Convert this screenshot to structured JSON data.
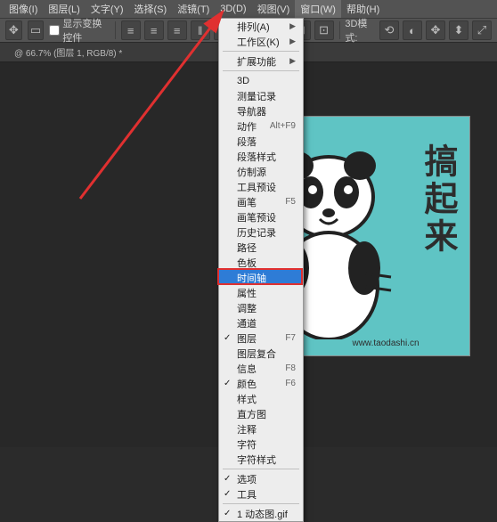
{
  "menubar": {
    "items": [
      "图像(I)",
      "图层(L)",
      "文字(Y)",
      "选择(S)",
      "滤镜(T)",
      "3D(D)",
      "视图(V)",
      "窗口(W)",
      "帮助(H)"
    ],
    "active_index": 7
  },
  "toolbar": {
    "checkbox_label": "显示变换控件",
    "btn_3d": "3D模式:"
  },
  "tab": {
    "label": "@ 66.7% (图层 1, RGB/8) *"
  },
  "dropdown": {
    "groups": [
      [
        {
          "label": "排列(A)",
          "sub": true
        },
        {
          "label": "工作区(K)",
          "sub": true
        }
      ],
      [
        {
          "label": "扩展功能",
          "sub": true
        }
      ],
      [
        {
          "label": "3D"
        },
        {
          "label": "测量记录"
        },
        {
          "label": "导航器"
        },
        {
          "label": "动作",
          "shortcut": "Alt+F9"
        },
        {
          "label": "段落"
        },
        {
          "label": "段落样式"
        },
        {
          "label": "仿制源"
        },
        {
          "label": "工具预设"
        },
        {
          "label": "画笔",
          "shortcut": "F5"
        },
        {
          "label": "画笔预设"
        },
        {
          "label": "历史记录"
        },
        {
          "label": "路径"
        },
        {
          "label": "色板"
        },
        {
          "label": "时间轴",
          "selected": true,
          "highlight": true
        },
        {
          "label": "属性"
        },
        {
          "label": "调整"
        },
        {
          "label": "通道"
        },
        {
          "label": "图层",
          "shortcut": "F7",
          "checked": true
        },
        {
          "label": "图层复合"
        },
        {
          "label": "信息",
          "shortcut": "F8"
        },
        {
          "label": "颜色",
          "shortcut": "F6",
          "checked": true
        },
        {
          "label": "样式"
        },
        {
          "label": "直方图"
        },
        {
          "label": "注释"
        },
        {
          "label": "字符"
        },
        {
          "label": "字符样式"
        }
      ],
      [
        {
          "label": "选项",
          "checked": true
        },
        {
          "label": "工具",
          "checked": true
        }
      ],
      [
        {
          "label": "1 动态图.gif",
          "checked": true
        }
      ]
    ]
  },
  "canvas": {
    "cn_text": "搞起来",
    "url": "www.taodashi.cn"
  }
}
